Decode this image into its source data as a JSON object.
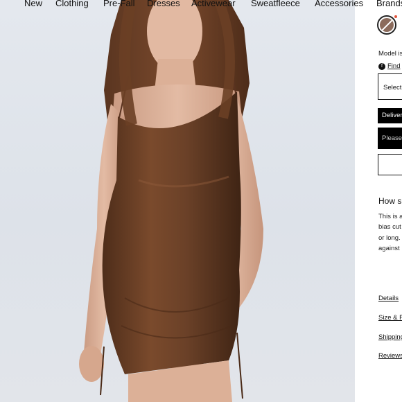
{
  "nav": {
    "items": [
      {
        "label": "New"
      },
      {
        "label": "Clothing"
      },
      {
        "label": "Pre-Fall"
      },
      {
        "label": "Dresses"
      },
      {
        "label": "Activewear"
      },
      {
        "label": "Sweatfleece"
      },
      {
        "label": "Accessories"
      },
      {
        "label": "Brands"
      }
    ]
  },
  "product": {
    "colors": {
      "background": "#e2e6ec",
      "dress": "#6b4128",
      "swatch": "#8b6b5c",
      "sale_dot": "#e2543c"
    },
    "swatch_icon": "color-swatch-icon",
    "model_text": "Model is",
    "find_text": "Find",
    "find_icon": "f-badge-icon",
    "select_label": "Select",
    "deliver_label": "Deliver",
    "please_label": "Please",
    "how_heading": "How s",
    "description_lines": [
      "This is a",
      "bias cut",
      "or long.",
      "against"
    ],
    "links": [
      "Details",
      "Size & F",
      "Shipping",
      "Reviews"
    ]
  }
}
